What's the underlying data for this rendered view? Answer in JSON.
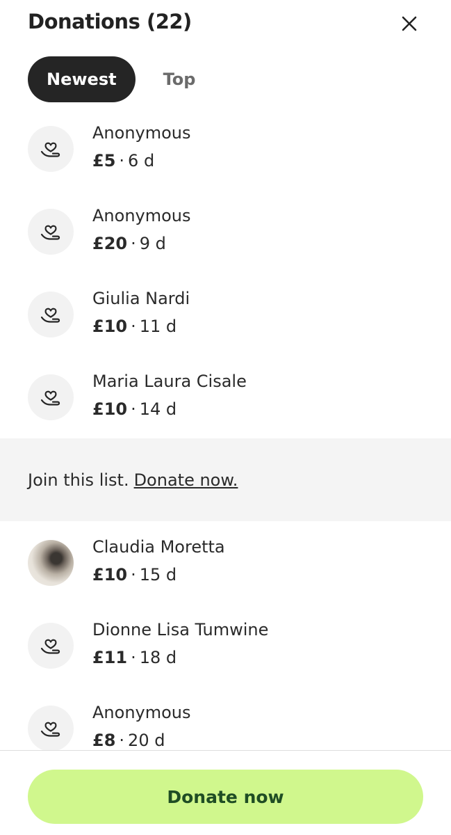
{
  "header": {
    "title": "Donations (22)"
  },
  "tabs": [
    {
      "label": "Newest",
      "active": true
    },
    {
      "label": "Top",
      "active": false
    }
  ],
  "donations_before": [
    {
      "name": "Anonymous",
      "amount": "£5",
      "age": "6 d",
      "avatar": "heart-hand-icon"
    },
    {
      "name": "Anonymous",
      "amount": "£20",
      "age": "9 d",
      "avatar": "heart-hand-icon"
    },
    {
      "name": "Giulia Nardi",
      "amount": "£10",
      "age": "11 d",
      "avatar": "heart-hand-icon"
    },
    {
      "name": "Maria Laura Cisale",
      "amount": "£10",
      "age": "14 d",
      "avatar": "heart-hand-icon"
    }
  ],
  "join_banner": {
    "text": "Join this list.",
    "link": "Donate now."
  },
  "donations_after": [
    {
      "name": "Claudia Moretta",
      "amount": "£10",
      "age": "15 d",
      "avatar": "profile-photo"
    },
    {
      "name": "Dionne Lisa Tumwine",
      "amount": "£11",
      "age": "18 d",
      "avatar": "heart-hand-icon"
    },
    {
      "name": "Anonymous",
      "amount": "£8",
      "age": "20 d",
      "avatar": "heart-hand-icon"
    }
  ],
  "separator": "·",
  "footer": {
    "button_label": "Donate now"
  },
  "colors": {
    "accent_button": "#d0f78d",
    "accent_button_text": "#1f4d24",
    "active_tab": "#252525",
    "banner_bg": "#f4f4f4",
    "avatar_bg": "#f2f2f2"
  }
}
